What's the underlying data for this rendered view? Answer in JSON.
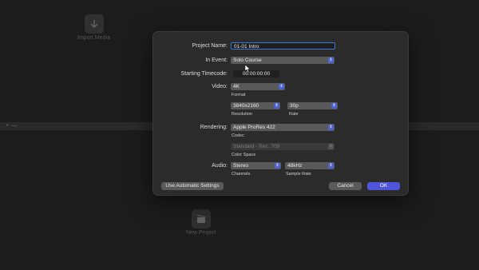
{
  "background": {
    "import_media_label": "Import Media",
    "new_project_label": "New Project"
  },
  "dialog": {
    "project_name": {
      "label": "Project Name:",
      "value": "01-01 Intro"
    },
    "in_event": {
      "label": "In Event:",
      "value": "Solo Course"
    },
    "starting_timecode": {
      "label": "Starting Timecode:",
      "value": "00:00:00:00"
    },
    "video": {
      "label": "Video:",
      "format": {
        "value": "4K",
        "sublabel": "Format"
      },
      "resolution": {
        "value": "3840x2160",
        "sublabel": "Resolution"
      },
      "rate": {
        "value": "30p",
        "sublabel": "Rate"
      }
    },
    "rendering": {
      "label": "Rendering:",
      "codec": {
        "value": "Apple ProRes 422",
        "sublabel": "Codec"
      },
      "color_space": {
        "value": "Standard - Rec. 709",
        "sublabel": "Color Space"
      }
    },
    "audio": {
      "label": "Audio:",
      "channels": {
        "value": "Stereo",
        "sublabel": "Channels"
      },
      "sample_rate": {
        "value": "48kHz",
        "sublabel": "Sample Rate"
      }
    },
    "buttons": {
      "automatic": "Use Automatic Settings",
      "cancel": "Cancel",
      "ok": "OK"
    }
  },
  "colors": {
    "accent": "#4f55d9",
    "focus": "#3a78d6"
  }
}
